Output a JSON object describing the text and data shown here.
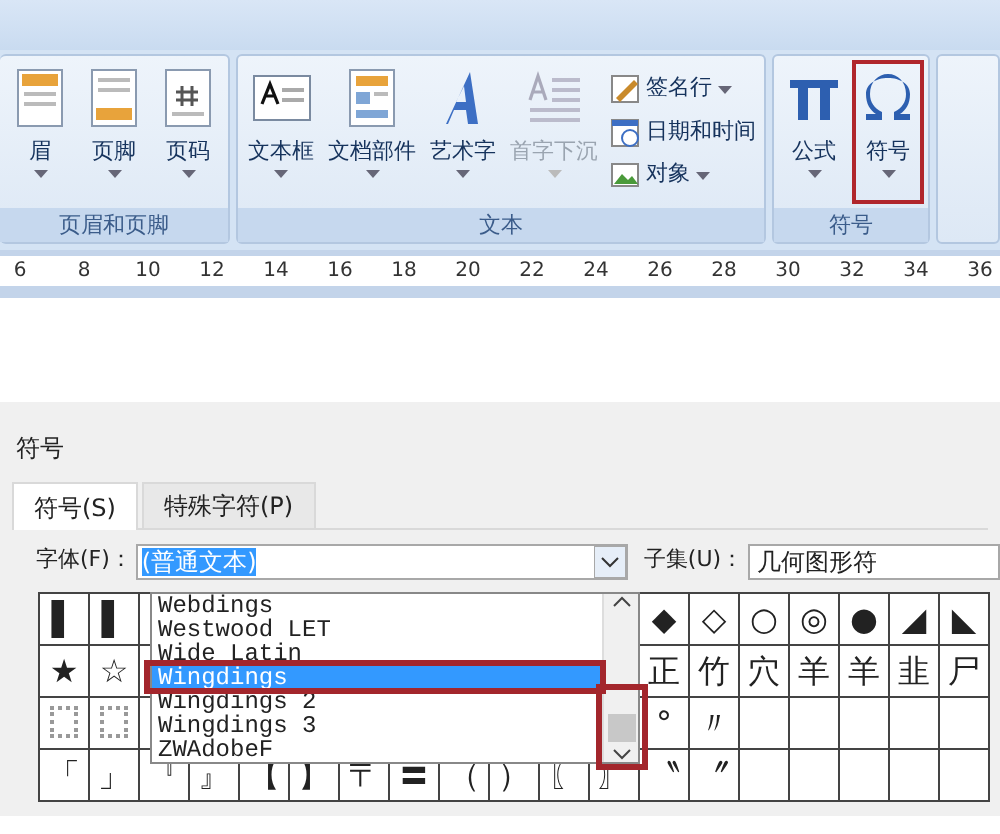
{
  "ribbon": {
    "groups": [
      {
        "label": "页眉和页脚",
        "buttons": [
          {
            "label": "眉",
            "disabled": false,
            "highlighted": false
          },
          {
            "label": "页脚",
            "disabled": false,
            "highlighted": false
          },
          {
            "label": "页码",
            "disabled": false,
            "highlighted": false
          }
        ]
      },
      {
        "label": "文本",
        "buttons": [
          {
            "label": "文本框",
            "disabled": false,
            "highlighted": false
          },
          {
            "label": "文档部件",
            "disabled": false,
            "highlighted": false
          },
          {
            "label": "艺术字",
            "disabled": false,
            "highlighted": false
          },
          {
            "label": "首字下沉",
            "disabled": true,
            "highlighted": false
          }
        ],
        "small_buttons": [
          {
            "label": "签名行",
            "dropdown": true
          },
          {
            "label": "日期和时间",
            "dropdown": false
          },
          {
            "label": "对象",
            "dropdown": true
          }
        ]
      },
      {
        "label": "符号",
        "buttons": [
          {
            "label": "公式",
            "disabled": false,
            "highlighted": false
          },
          {
            "label": "符号",
            "disabled": false,
            "highlighted": true
          }
        ]
      }
    ]
  },
  "ruler": {
    "numbers": [
      "6",
      "8",
      "10",
      "12",
      "14",
      "16",
      "18",
      "20",
      "22",
      "24",
      "26",
      "28",
      "30",
      "32",
      "34",
      "36"
    ]
  },
  "dialog": {
    "title": "符号",
    "tabs": [
      {
        "label": "符号(S)",
        "selected": true
      },
      {
        "label": "特殊字符(P)",
        "selected": false
      }
    ],
    "font": {
      "label": "字体(F)：",
      "value": "(普通文本)",
      "scrollbar_highlighted": true,
      "options": [
        {
          "label": "Webdings",
          "selected": false
        },
        {
          "label": "Westwood LET",
          "selected": false
        },
        {
          "label": "Wide Latin",
          "selected": false
        },
        {
          "label": "Wingdings",
          "selected": true
        },
        {
          "label": "Wingdings 2",
          "selected": false
        },
        {
          "label": "Wingdings 3",
          "selected": false
        },
        {
          "label": "ZWAdobeF",
          "selected": false
        }
      ]
    },
    "subset": {
      "label": "子集(U)：",
      "value": "几何图形符"
    },
    "grid": [
      [
        {
          "kind": "glyph",
          "text": "▌"
        },
        {
          "kind": "glyph",
          "text": "▌"
        },
        {
          "kind": "blank"
        },
        {
          "kind": "blank"
        },
        {
          "kind": "blank"
        },
        {
          "kind": "blank"
        },
        {
          "kind": "blank"
        },
        {
          "kind": "blank"
        },
        {
          "kind": "blank"
        },
        {
          "kind": "blank"
        },
        {
          "kind": "blank"
        },
        {
          "kind": "blank"
        },
        {
          "kind": "glyph",
          "text": "◆"
        },
        {
          "kind": "glyph",
          "text": "◇"
        },
        {
          "kind": "glyph",
          "text": "○"
        },
        {
          "kind": "glyph",
          "text": "◎"
        },
        {
          "kind": "glyph",
          "text": "●"
        },
        {
          "kind": "glyph",
          "text": "◢"
        },
        {
          "kind": "glyph",
          "text": "◣"
        }
      ],
      [
        {
          "kind": "glyph",
          "text": "★"
        },
        {
          "kind": "glyph",
          "text": "☆"
        },
        {
          "kind": "blank"
        },
        {
          "kind": "blank"
        },
        {
          "kind": "blank"
        },
        {
          "kind": "blank"
        },
        {
          "kind": "blank"
        },
        {
          "kind": "blank"
        },
        {
          "kind": "blank"
        },
        {
          "kind": "blank"
        },
        {
          "kind": "blank"
        },
        {
          "kind": "blank"
        },
        {
          "kind": "glyph",
          "text": "正"
        },
        {
          "kind": "glyph",
          "text": "竹"
        },
        {
          "kind": "glyph",
          "text": "穴"
        },
        {
          "kind": "glyph",
          "text": "羊"
        },
        {
          "kind": "glyph",
          "text": "羊"
        },
        {
          "kind": "glyph",
          "text": "韭"
        },
        {
          "kind": "glyph",
          "text": "尸"
        }
      ],
      [
        {
          "kind": "dots"
        },
        {
          "kind": "dots"
        },
        {
          "kind": "blank"
        },
        {
          "kind": "blank"
        },
        {
          "kind": "blank"
        },
        {
          "kind": "blank"
        },
        {
          "kind": "blank"
        },
        {
          "kind": "blank"
        },
        {
          "kind": "blank"
        },
        {
          "kind": "blank"
        },
        {
          "kind": "blank"
        },
        {
          "kind": "blank"
        },
        {
          "kind": "glyph",
          "text": "°"
        },
        {
          "kind": "glyph",
          "text": "〃"
        },
        {
          "kind": "blank"
        },
        {
          "kind": "blank"
        },
        {
          "kind": "blank"
        },
        {
          "kind": "blank"
        },
        {
          "kind": "blank"
        }
      ],
      [
        {
          "kind": "glyph",
          "text": "「"
        },
        {
          "kind": "glyph",
          "text": "」"
        },
        {
          "kind": "glyph",
          "text": "『"
        },
        {
          "kind": "glyph",
          "text": "』"
        },
        {
          "kind": "glyph",
          "text": "【"
        },
        {
          "kind": "glyph",
          "text": "】"
        },
        {
          "kind": "glyph",
          "text": "〒"
        },
        {
          "kind": "glyph",
          "text": "〓"
        },
        {
          "kind": "glyph",
          "text": "（"
        },
        {
          "kind": "glyph",
          "text": "）"
        },
        {
          "kind": "glyph",
          "text": "〖"
        },
        {
          "kind": "glyph",
          "text": "〗"
        },
        {
          "kind": "glyph",
          "text": "〝"
        },
        {
          "kind": "glyph",
          "text": "〞"
        },
        {
          "kind": "blank"
        },
        {
          "kind": "blank"
        },
        {
          "kind": "blank"
        },
        {
          "kind": "blank"
        },
        {
          "kind": "blank"
        }
      ]
    ]
  }
}
